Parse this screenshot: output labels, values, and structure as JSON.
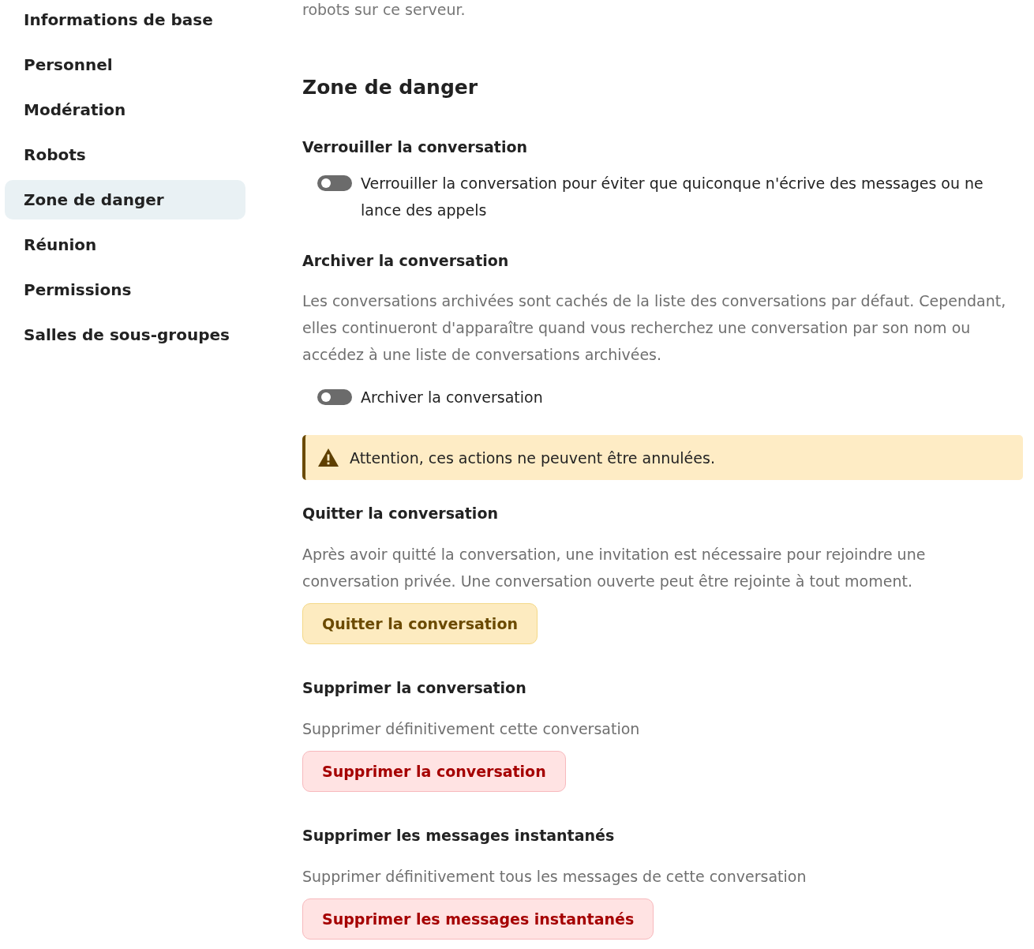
{
  "sidebar": {
    "items": [
      {
        "label": "Informations de base",
        "selected": false
      },
      {
        "label": "Personnel",
        "selected": false
      },
      {
        "label": "Modération",
        "selected": false
      },
      {
        "label": "Robots",
        "selected": false
      },
      {
        "label": "Zone de danger",
        "selected": true
      },
      {
        "label": "Réunion",
        "selected": false
      },
      {
        "label": "Permissions",
        "selected": false
      },
      {
        "label": "Salles de sous-groupes",
        "selected": false
      }
    ]
  },
  "main": {
    "previous_text": "robots sur ce serveur.",
    "title": "Zone de danger",
    "sections": [
      {
        "kind": "toggle",
        "heading": "Verrouiller la conversation",
        "toggle": {
          "label": "Verrouiller la conversation pour éviter que quiconque n'écrive des messages ou ne lance des appels",
          "checked": false
        }
      },
      {
        "kind": "toggle",
        "heading": "Archiver la conversation",
        "description": "Les conversations archivées sont cachés de la liste des conversations par défaut. Cependant, elles continueront d'apparaître quand vous recherchez une conversation par son nom ou accédez à une liste de conversations archivées.",
        "toggle": {
          "label": "Archiver la conversation",
          "checked": false
        }
      },
      {
        "kind": "warning",
        "text": "Attention, ces actions ne peuvent être annulées."
      },
      {
        "kind": "action",
        "heading": "Quitter la conversation",
        "description": "Après avoir quitté la conversation, une invitation est nécessaire pour rejoindre une conversation privée. Une conversation ouverte peut être rejointe à tout moment.",
        "button": {
          "label": "Quitter la conversation",
          "kind": "warning"
        }
      },
      {
        "kind": "action",
        "heading": "Supprimer la conversation",
        "description": "Supprimer définitivement cette conversation",
        "button": {
          "label": "Supprimer la conversation",
          "kind": "danger"
        }
      },
      {
        "kind": "action",
        "heading": "Supprimer les messages instantanés",
        "description": "Supprimer définitivement tous les messages de cette conversation",
        "button": {
          "label": "Supprimer les messages instantanés",
          "kind": "danger"
        }
      }
    ]
  }
}
